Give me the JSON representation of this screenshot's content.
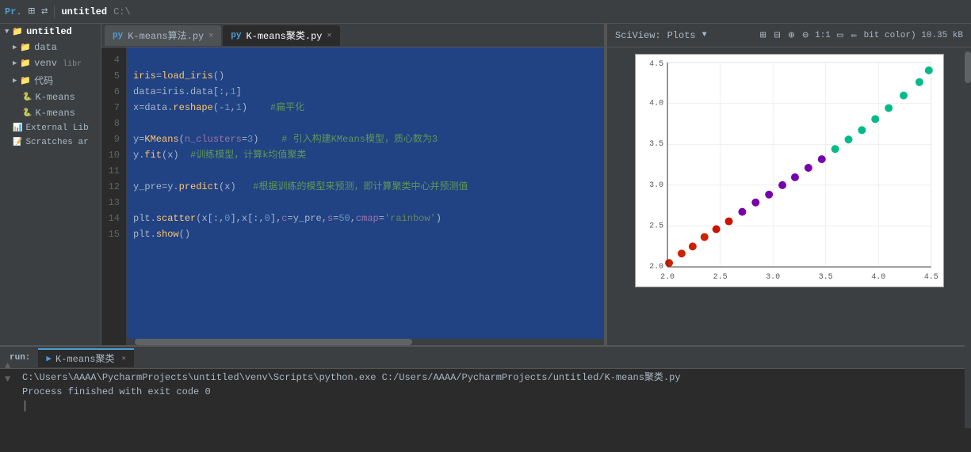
{
  "header": {
    "project_icon": "Pr",
    "icons": [
      "grid-icon",
      "arrows-icon"
    ],
    "project_name": "untitled",
    "project_path": "C:\\"
  },
  "tabs": [
    {
      "id": "tab1",
      "icon": "py",
      "label": "K-means算法.py",
      "active": false
    },
    {
      "id": "tab2",
      "icon": "py",
      "label": "K-means聚类.py",
      "active": true
    }
  ],
  "sciview": {
    "label": "SciView:",
    "plots_label": "Plots",
    "tools": [
      "grid2-icon",
      "table-icon",
      "zoom-in-icon",
      "zoom-out-icon",
      "1:1-icon",
      "rect-icon",
      "pen-icon"
    ],
    "size_label": "bit color) 10.35 kB"
  },
  "sidebar": {
    "header": "Pr...",
    "items": [
      {
        "level": 0,
        "type": "folder",
        "label": "untitled",
        "expanded": true
      },
      {
        "level": 1,
        "type": "folder",
        "label": "data",
        "expanded": false
      },
      {
        "level": 1,
        "type": "folder",
        "label": "venv",
        "expanded": false,
        "suffix": "libr"
      },
      {
        "level": 1,
        "type": "folder",
        "label": "代码",
        "expanded": false
      },
      {
        "level": 2,
        "type": "file",
        "label": "K-means"
      },
      {
        "level": 2,
        "type": "file",
        "label": "K-means"
      },
      {
        "level": 1,
        "type": "special",
        "label": "External Lib",
        "suffix": ""
      },
      {
        "level": 1,
        "type": "special",
        "label": "Scratches ar"
      }
    ]
  },
  "code": {
    "lines": [
      {
        "num": 4,
        "content": ""
      },
      {
        "num": 5,
        "content": "iris=load_iris()"
      },
      {
        "num": 6,
        "content": "data=iris.data[:,<span class='num'>1</span>]"
      },
      {
        "num": 7,
        "content": "x=data.reshape(-1,<span class='num'>1</span>)    <span class='comment'>#扁平化</span>"
      },
      {
        "num": 8,
        "content": ""
      },
      {
        "num": 9,
        "content": "y=KMeans(n_clusters=<span class='num'>3</span>)    <span class='comment'># 引入构建KMeans模型，质心数为3</span>"
      },
      {
        "num": 10,
        "content": "y.fit(x)  <span class='comment'>#训练模型，计算k均值聚类</span>"
      },
      {
        "num": 11,
        "content": ""
      },
      {
        "num": 12,
        "content": "y_pre=y.predict(x)   <span class='comment'>#根据训练的模型来预测，即计算聚类中心并预测值</span>"
      },
      {
        "num": 13,
        "content": ""
      },
      {
        "num": 14,
        "content": "plt.scatter(x[:,<span class='num'>0</span>],x[:,<span class='num'>0</span>],c=y_pre,s=<span class='num'>50</span>,cmap=<span class='str'>'rainbow'</span>)"
      },
      {
        "num": 15,
        "content": "plt.show()"
      }
    ]
  },
  "run_panel": {
    "run_label": "run:",
    "tab_label": "K-means聚类",
    "output_line1": "C:\\Users\\AAAA\\PycharmProjects\\untitled\\venv\\Scripts\\python.exe C:/Users/AAAA/PycharmProjects/untitled/K-means聚类.py",
    "output_line2": "Process finished with exit code 0",
    "cursor": "│"
  },
  "scatter": {
    "x_ticks": [
      "2.0",
      "2.5",
      "3.0",
      "3.5",
      "4.0",
      "4.5"
    ],
    "y_ticks": [
      "2.0",
      "2.5",
      "3.0",
      "3.5",
      "4.0",
      "4.5"
    ],
    "points": [
      {
        "x": 20,
        "y": 265,
        "color": "#cc0000"
      },
      {
        "x": 45,
        "y": 247,
        "color": "#cc0000"
      },
      {
        "x": 65,
        "y": 235,
        "color": "#cc0000"
      },
      {
        "x": 80,
        "y": 224,
        "color": "#cc0000"
      },
      {
        "x": 100,
        "y": 212,
        "color": "#cc0000"
      },
      {
        "x": 115,
        "y": 200,
        "color": "#cc0000"
      },
      {
        "x": 135,
        "y": 188,
        "color": "#8b008b"
      },
      {
        "x": 155,
        "y": 177,
        "color": "#8b008b"
      },
      {
        "x": 175,
        "y": 165,
        "color": "#8b008b"
      },
      {
        "x": 195,
        "y": 152,
        "color": "#8b008b"
      },
      {
        "x": 215,
        "y": 140,
        "color": "#8b008b"
      },
      {
        "x": 235,
        "y": 128,
        "color": "#8b008b"
      },
      {
        "x": 255,
        "y": 116,
        "color": "#8b008b"
      },
      {
        "x": 275,
        "y": 104,
        "color": "#00cc99"
      },
      {
        "x": 295,
        "y": 92,
        "color": "#00cc99"
      },
      {
        "x": 315,
        "y": 78,
        "color": "#00cc99"
      },
      {
        "x": 335,
        "y": 64,
        "color": "#00cc99"
      },
      {
        "x": 350,
        "y": 50,
        "color": "#00cc99"
      },
      {
        "x": 365,
        "y": 36,
        "color": "#00cc99"
      },
      {
        "x": 375,
        "y": 22,
        "color": "#00cc99"
      }
    ]
  }
}
